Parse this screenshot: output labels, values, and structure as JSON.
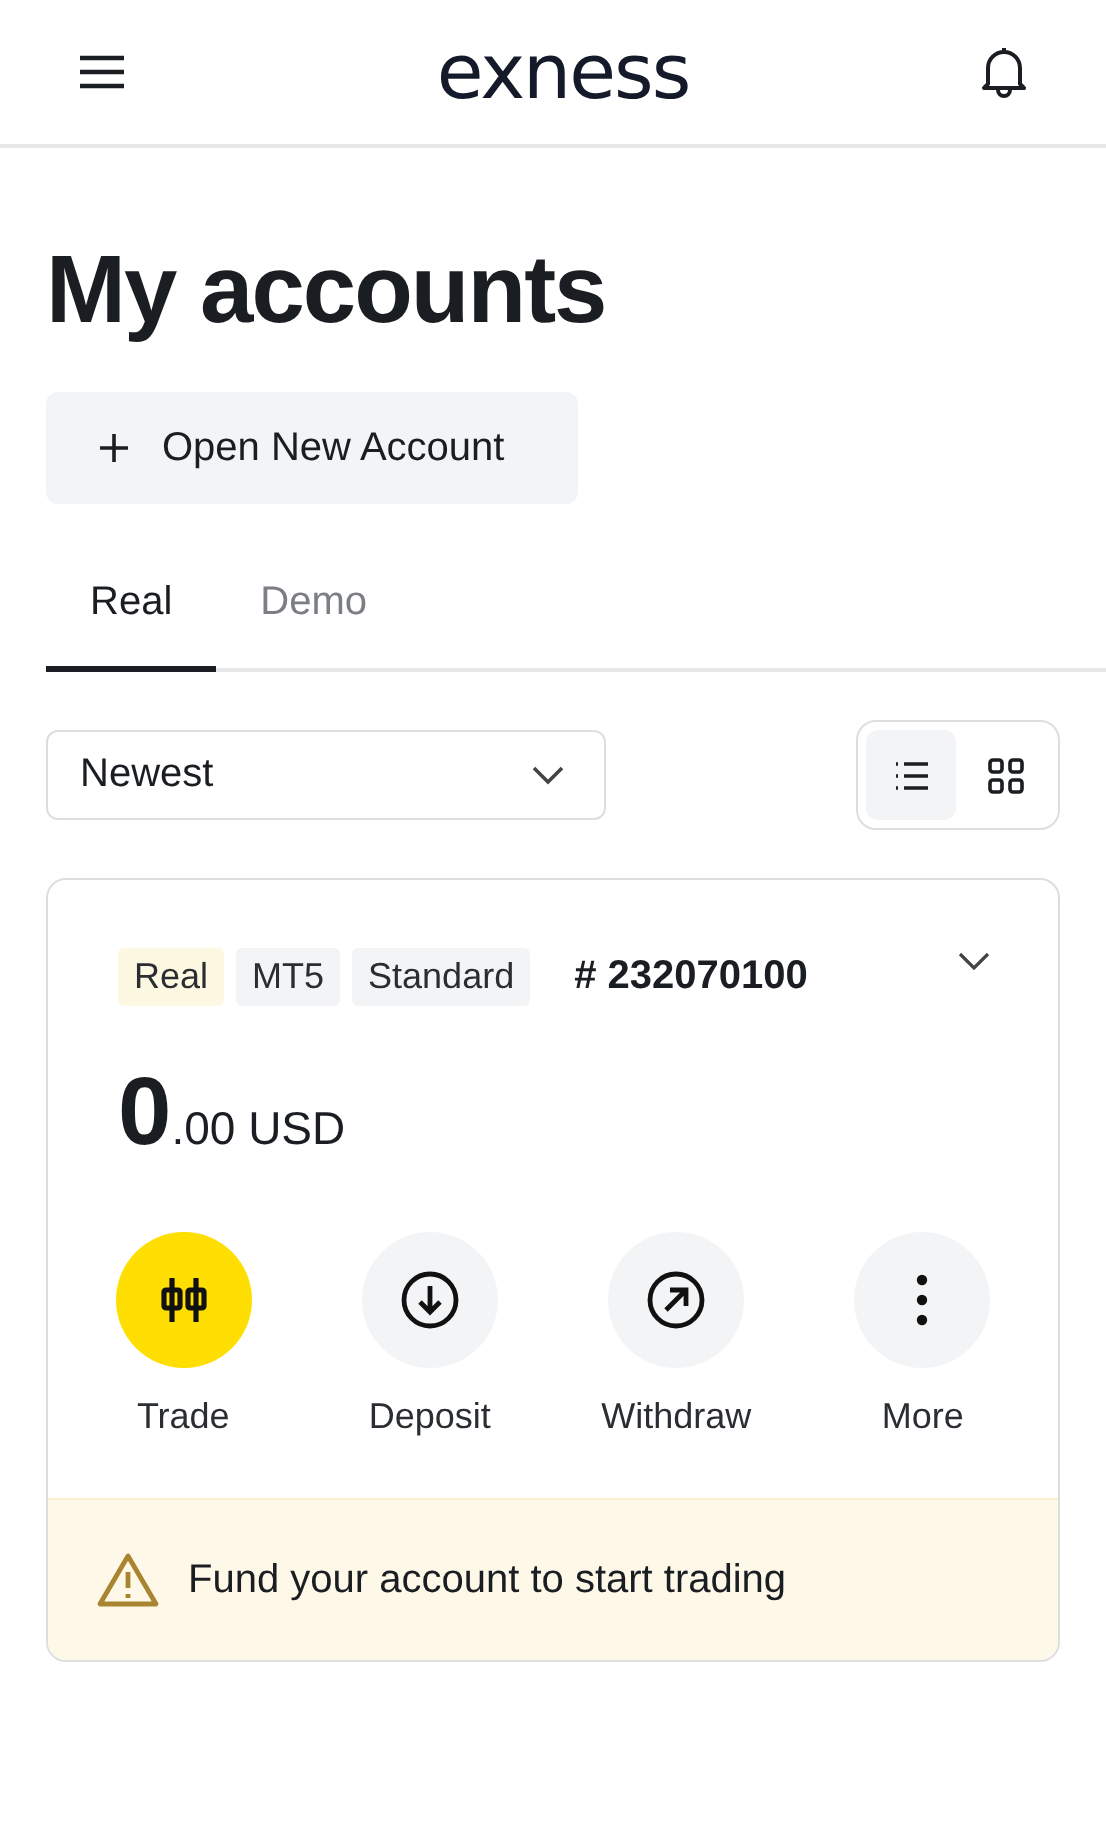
{
  "header": {
    "logo": "exness"
  },
  "title": "My accounts",
  "open_button": {
    "label": "Open New Account"
  },
  "tabs": [
    {
      "label": "Real",
      "selected": true
    },
    {
      "label": "Demo",
      "selected": false
    }
  ],
  "sort": {
    "value": "Newest"
  },
  "view_toggle": [
    {
      "kind": "list",
      "selected": true
    },
    {
      "kind": "grid",
      "selected": false
    }
  ],
  "account": {
    "tags": [
      {
        "label": "Real",
        "color": "#fdf8e1"
      },
      {
        "label": "MT5",
        "color": "#f3f4f6"
      },
      {
        "label": "Standard",
        "color": "#f3f4f6"
      }
    ],
    "number": "# 232070100",
    "balance_whole": "0",
    "balance_rest": ".00 USD",
    "actions": [
      {
        "kind": "trade",
        "label": "Trade",
        "highlighted": true
      },
      {
        "kind": "deposit",
        "label": "Deposit",
        "highlighted": false
      },
      {
        "kind": "withdraw",
        "label": "Withdraw",
        "highlighted": false
      },
      {
        "kind": "more",
        "label": "More",
        "highlighted": false
      }
    ],
    "notice": "Fund your account to start trading"
  }
}
